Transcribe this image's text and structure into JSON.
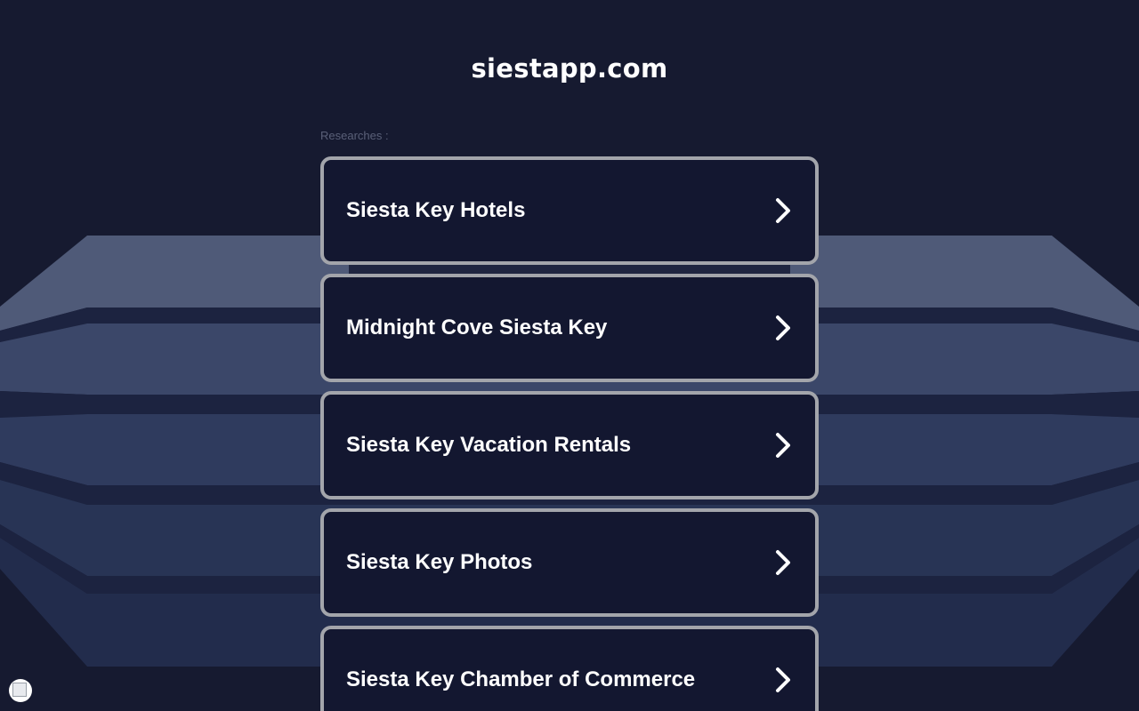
{
  "site": {
    "title": "siestapp.com"
  },
  "section": {
    "label": "Researches :"
  },
  "results": [
    {
      "label": "Siesta Key Hotels",
      "icon": "chevron-right-icon"
    },
    {
      "label": "Midnight Cove Siesta Key",
      "icon": "chevron-right-icon"
    },
    {
      "label": "Siesta Key Vacation Rentals",
      "icon": "chevron-right-icon"
    },
    {
      "label": "Siesta Key Photos",
      "icon": "chevron-right-icon"
    },
    {
      "label": "Siesta Key Chamber of Commerce",
      "icon": "chevron-right-icon"
    }
  ],
  "colors": {
    "background": "#161a30",
    "card_background": "#131730",
    "card_border": "#a3a5ab",
    "text": "#ffffff",
    "muted_text": "#5a6078",
    "band_light": "#4f5a78",
    "band_mid": "#2f3b5e",
    "band_dark": "#1e2747"
  }
}
